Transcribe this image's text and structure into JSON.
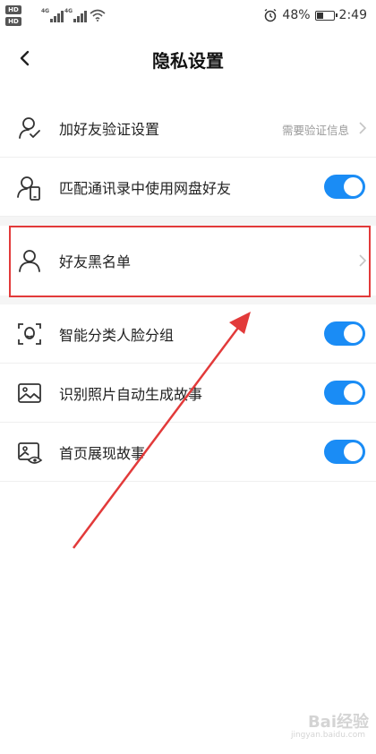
{
  "status_bar": {
    "hd_badge": "HD",
    "network_1": "4G",
    "network_2": "4G",
    "battery_percent": "48%",
    "battery_level": 0.48,
    "time": "2:49"
  },
  "header": {
    "title": "隐私设置"
  },
  "settings": [
    {
      "label": "加好友验证设置",
      "value": "需要验证信息",
      "icon": "user-check-icon"
    },
    {
      "label": "匹配通讯录中使用网盘好友",
      "toggle": true,
      "icon": "contacts-phone-icon"
    },
    {
      "label": "好友黑名单",
      "icon": "user-icon"
    },
    {
      "label": "智能分类人脸分组",
      "toggle": true,
      "icon": "face-scan-icon"
    },
    {
      "label": "识别照片自动生成故事",
      "toggle": true,
      "icon": "image-icon"
    },
    {
      "label": "首页展现故事",
      "toggle": true,
      "icon": "image-eye-icon"
    }
  ],
  "annotation": {
    "highlight_color": "#e23a3a",
    "arrow_color": "#e23a3a"
  },
  "watermark": {
    "brand": "Bai经验",
    "site": "jingyan.baidu.com"
  },
  "colors": {
    "toggle_on": "#1a8cf5"
  }
}
